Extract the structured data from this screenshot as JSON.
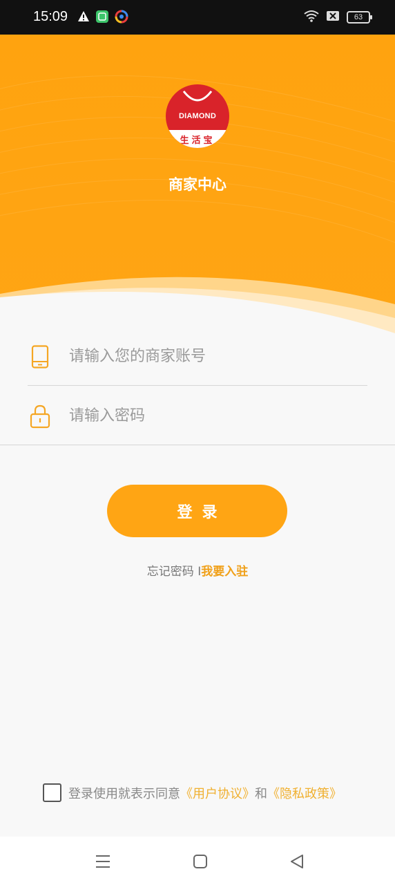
{
  "status_bar": {
    "time": "15:09",
    "battery": "63",
    "icons": [
      "warning-icon",
      "app-icon",
      "browser-icon",
      "wifi-icon",
      "sim-off-icon",
      "battery-icon"
    ]
  },
  "header": {
    "logo_text": "DIAMOND",
    "logo_cn": "生活宝",
    "title": "商家中心",
    "colors": {
      "primary": "#ffa514",
      "logo_red": "#d9232a"
    }
  },
  "form": {
    "account_placeholder": "请输入您的商家账号",
    "password_placeholder": "请输入密码",
    "login_label": "登录"
  },
  "links": {
    "forgot": "忘记密码",
    "separator": "I",
    "register": "我要入驻"
  },
  "agreement": {
    "text": "登录使用就表示同意",
    "user_agreement": "《用户协议》",
    "and": "和",
    "privacy_policy": "《隐私政策》",
    "checked": false
  },
  "navbar": {
    "icons": [
      "menu-icon",
      "home-icon",
      "back-icon"
    ]
  }
}
